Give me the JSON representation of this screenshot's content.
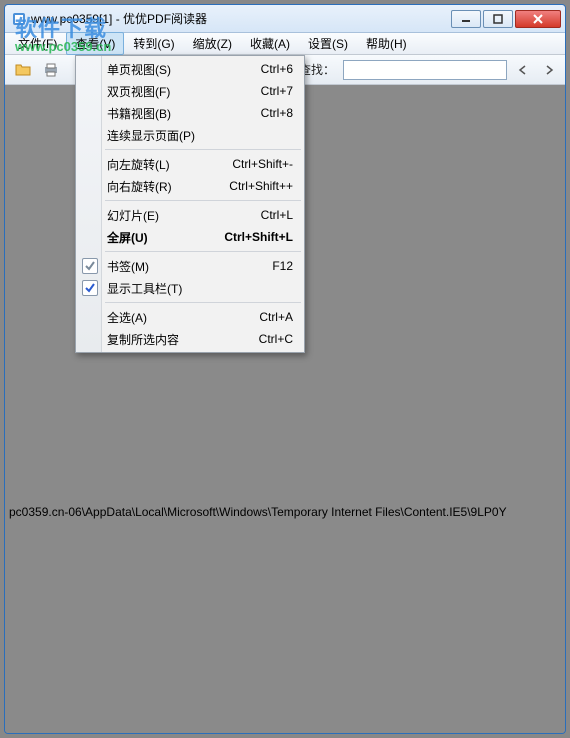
{
  "window": {
    "title": "www.pc0359[1] - 优优PDF阅读器"
  },
  "menubar": {
    "items": [
      {
        "label": "文件(F)"
      },
      {
        "label": "查看(V)"
      },
      {
        "label": "转到(G)"
      },
      {
        "label": "缩放(Z)"
      },
      {
        "label": "收藏(A)"
      },
      {
        "label": "设置(S)"
      },
      {
        "label": "帮助(H)"
      }
    ]
  },
  "toolbar": {
    "search_label": "查找：",
    "search_value": ""
  },
  "dropdown": {
    "items": [
      {
        "label": "单页视图(S)",
        "shortcut": "Ctrl+6"
      },
      {
        "label": "双页视图(F)",
        "shortcut": "Ctrl+7"
      },
      {
        "label": "书籍视图(B)",
        "shortcut": "Ctrl+8"
      },
      {
        "label": "连续显示页面(P)",
        "shortcut": ""
      },
      {
        "sep": true
      },
      {
        "label": "向左旋转(L)",
        "shortcut": "Ctrl+Shift+-"
      },
      {
        "label": "向右旋转(R)",
        "shortcut": "Ctrl+Shift++"
      },
      {
        "sep": true
      },
      {
        "label": "幻灯片(E)",
        "shortcut": "Ctrl+L"
      },
      {
        "label": "全屏(U)",
        "shortcut": "Ctrl+Shift+L",
        "bold": true
      },
      {
        "sep": true
      },
      {
        "label": "书签(M)",
        "shortcut": "F12",
        "check": "blank"
      },
      {
        "label": "显示工具栏(T)",
        "shortcut": "",
        "check": "checked"
      },
      {
        "sep": true
      },
      {
        "label": "全选(A)",
        "shortcut": "Ctrl+A"
      },
      {
        "label": "复制所选内容",
        "shortcut": "Ctrl+C"
      }
    ]
  },
  "watermark": {
    "big": "软件下载",
    "url": "www.pc0359.cn"
  },
  "path_text": "pc0359.cn-06\\AppData\\Local\\Microsoft\\Windows\\Temporary Internet Files\\Content.IE5\\9LP0Y"
}
